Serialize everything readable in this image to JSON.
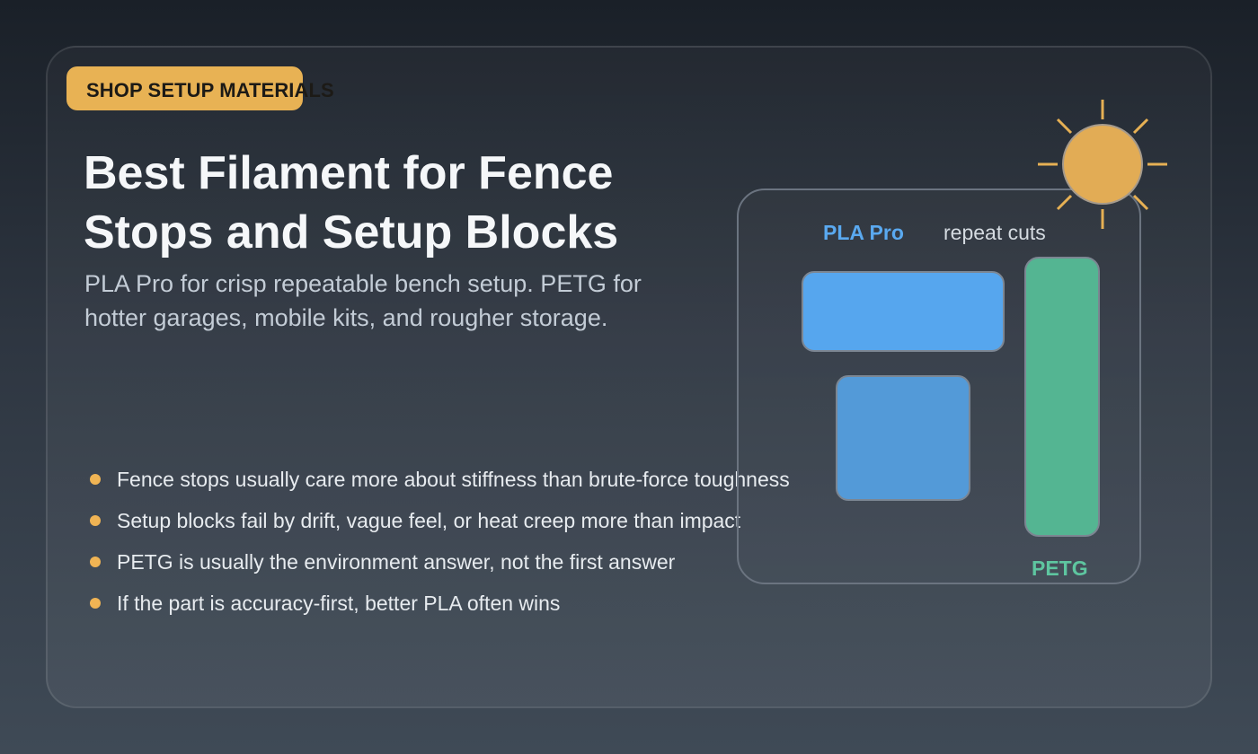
{
  "badge": {
    "label": "SHOP SETUP MATERIALS"
  },
  "hero": {
    "title": "Best Filament for Fence Stops and Setup Blocks",
    "subtitle": "PLA Pro for crisp repeatable bench setup. PETG for hotter garages, mobile kits, and rougher storage."
  },
  "bullets": [
    "Fence stops usually care more about stiffness than brute-force toughness",
    "Setup blocks fail by drift, vague feel, or heat creep more than impact",
    "PETG is usually the environment answer, not the first answer",
    "If the part is accuracy-first, better PLA often wins"
  ],
  "illustration": {
    "pla_label": "PLA Pro",
    "repeat_label": "repeat cuts",
    "petg_label": "PETG",
    "icon": "sun-icon"
  },
  "colors": {
    "accent": "#e8b254",
    "pla_blue": "#5aa9f0",
    "pla_blue_dark": "#539ad8",
    "petg_green": "#54b592",
    "bullet_dot": "#f0b454"
  }
}
